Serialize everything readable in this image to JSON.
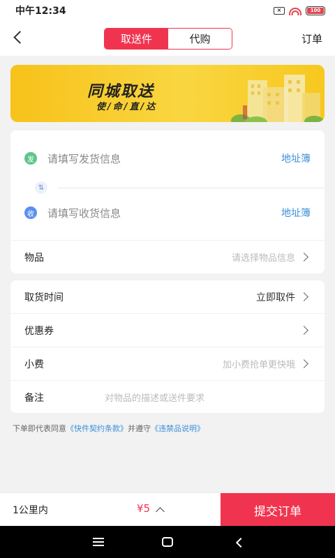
{
  "status_bar": {
    "time": "中午12:34",
    "battery": "100"
  },
  "nav": {
    "tabs": [
      {
        "label": "取送件",
        "active": true
      },
      {
        "label": "代购",
        "active": false
      }
    ],
    "orders_label": "订单"
  },
  "banner": {
    "title": "同城取送",
    "subtitle": "使/命/直/达"
  },
  "address": {
    "send": {
      "badge": "发",
      "placeholder": "请填写发货信息",
      "book": "地址簿"
    },
    "swap_icon": "⇅",
    "receive": {
      "badge": "收",
      "placeholder": "请填写收货信息",
      "book": "地址簿"
    }
  },
  "goods": {
    "label": "物品",
    "placeholder": "请选择物品信息"
  },
  "form": {
    "pickup_time": {
      "label": "取货时间",
      "value": "立即取件"
    },
    "coupon": {
      "label": "优惠券",
      "value": ""
    },
    "tip": {
      "label": "小费",
      "placeholder": "加小费抢单更快哦"
    },
    "remark": {
      "label": "备注",
      "placeholder": "对物品的描述或送件要求"
    }
  },
  "agreement": {
    "prefix": "下单即代表同意",
    "terms": "《快件契约条款》",
    "middle": "并遵守",
    "prohibited": "《违禁品说明》"
  },
  "bottom": {
    "distance": "1公里内",
    "price": "¥5",
    "submit": "提交订单"
  },
  "colors": {
    "accent": "#f0344f",
    "link": "#3a8fd8",
    "banner": "#f7c21a"
  }
}
